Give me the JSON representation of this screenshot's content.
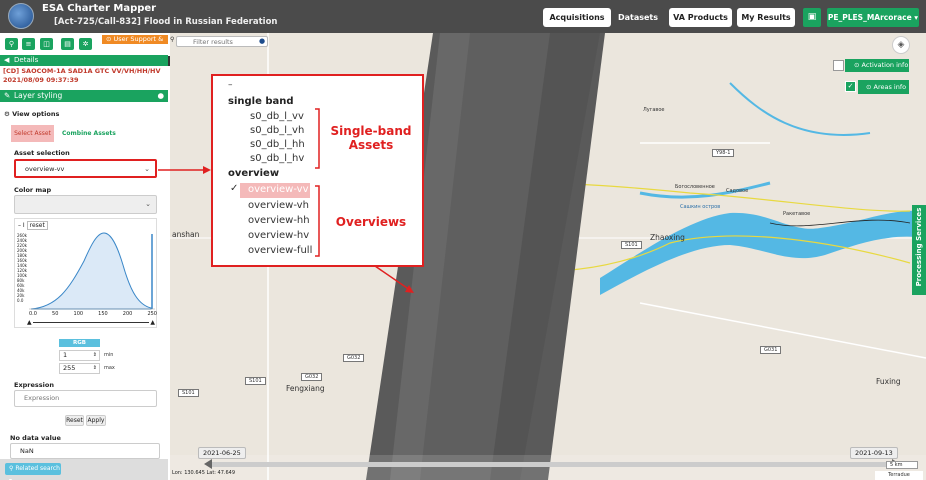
{
  "header": {
    "app_title": "ESA Charter Mapper",
    "activation_title": "[Act-725/Call-832] Flood in Russian Federation",
    "nav": [
      "Acquisitions",
      "Datasets",
      "VA Products",
      "My Results"
    ],
    "user": "PE_PLES_MArcorace"
  },
  "sidebar": {
    "support_label": "User Support & UM",
    "details_label": "Details",
    "asset_name": "[CD] SAOCOM-1A SAD1A GTC VV/VH/HH/HV 2021/08/09 09:37:39",
    "layer_styling_label": "Layer styling",
    "view_options_label": "View options",
    "select_asset_tab": "Select Asset",
    "combine_assets_tab": "Combine Assets",
    "asset_selection_label": "Asset selection",
    "asset_selection_value": "overview-vv",
    "color_map_label": "Color map",
    "color_map_value": "",
    "histogram": {
      "reset_label": "reset",
      "y_ticks": [
        "260k",
        "240k",
        "220k",
        "200k",
        "180k",
        "160k",
        "140k",
        "120k",
        "100k",
        "80k",
        "60k",
        "40k",
        "20k",
        "0.0"
      ],
      "x_ticks": [
        "0.0",
        "50",
        "100",
        "150",
        "200",
        "250"
      ]
    },
    "rgb_label": "RGB",
    "min_value": "1",
    "max_value": "255",
    "min_label": "min",
    "max_label": "max",
    "expression_label": "Expression",
    "expression_placeholder": "Expression",
    "reset_button": "Reset",
    "apply_button": "Apply",
    "no_data_label": "No data value",
    "no_data_value": "NaN",
    "related_search": "Related search"
  },
  "map": {
    "filter_placeholder": "Filter results",
    "activation_info": "Activation info",
    "areas_info": "Areas info",
    "processing_services": "Processing Services",
    "places": [
      "Fengxiang",
      "Fuxing",
      "Zhaoxing",
      "anshan",
      "Лугавое",
      "Богословенное",
      "Садовое",
      "Ракетавое",
      "Сашкин остров"
    ],
    "road_labels": [
      "Y98-1",
      "S101",
      "G032",
      "G032",
      "S101",
      "S101",
      "G031"
    ],
    "timeline_start": "2021-06-25",
    "timeline_end": "2021-09-13",
    "scale": "5 km",
    "attribution": "Terradue",
    "coordinates": "Lon: 130.645 Lat: 47.649"
  },
  "callout": {
    "dash": "–",
    "group1": "single band",
    "single_band": [
      "s0_db_l_vv",
      "s0_db_l_vh",
      "s0_db_l_hh",
      "s0_db_l_hv"
    ],
    "group2": "overview",
    "check": "✓",
    "overviews": [
      "overview-vv",
      "overview-vh",
      "overview-hh",
      "overview-hv",
      "overview-full"
    ],
    "label_single": "Single-band Assets",
    "label_overviews": "Overviews"
  }
}
